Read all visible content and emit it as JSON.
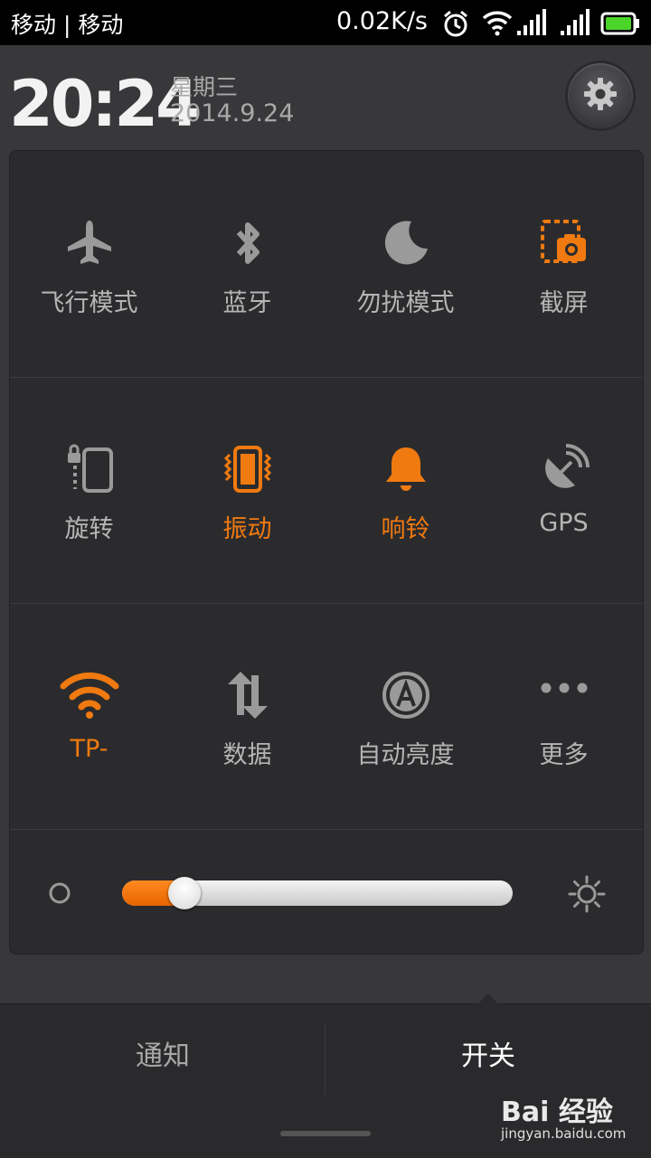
{
  "status_bar": {
    "carrier": "移动 | 移动",
    "net_speed": "0.02K/s",
    "icons": [
      "alarm-clock-icon",
      "wifi-icon",
      "signal-icon",
      "signal-icon",
      "battery-icon"
    ]
  },
  "header": {
    "time": "20:24",
    "weekday": "星期三",
    "date": "2014.9.24",
    "settings_icon": "gear-icon"
  },
  "toggles": [
    {
      "label": "飞行模式",
      "icon": "airplane-icon",
      "active": false
    },
    {
      "label": "蓝牙",
      "icon": "bluetooth-icon",
      "active": false
    },
    {
      "label": "勿扰模式",
      "icon": "moon-icon",
      "active": false
    },
    {
      "label": "截屏",
      "icon": "screenshot-icon",
      "active": true
    },
    {
      "label": "旋转",
      "icon": "rotate-lock-icon",
      "active": false
    },
    {
      "label": "振动",
      "icon": "vibrate-icon",
      "active": true
    },
    {
      "label": "响铃",
      "icon": "bell-icon",
      "active": true
    },
    {
      "label": "GPS",
      "icon": "gps-icon",
      "active": false
    },
    {
      "label": "TP-",
      "icon": "wifi-icon",
      "active": true
    },
    {
      "label": "数据",
      "icon": "data-icon",
      "active": false
    },
    {
      "label": "自动亮度",
      "icon": "auto-brightness-icon",
      "active": false
    },
    {
      "label": "更多",
      "icon": "more-icon",
      "active": false
    }
  ],
  "brightness": {
    "level": 0.16,
    "min_icon": "circle-icon",
    "max_icon": "sun-icon"
  },
  "bottom_tabs": {
    "notify": "通知",
    "switch": "开关"
  },
  "watermark": {
    "logo": "Bai 经验",
    "url": "jingyan.baidu.com"
  },
  "colors": {
    "accent": "#f07a10",
    "inactive": "#b5b5b5"
  }
}
